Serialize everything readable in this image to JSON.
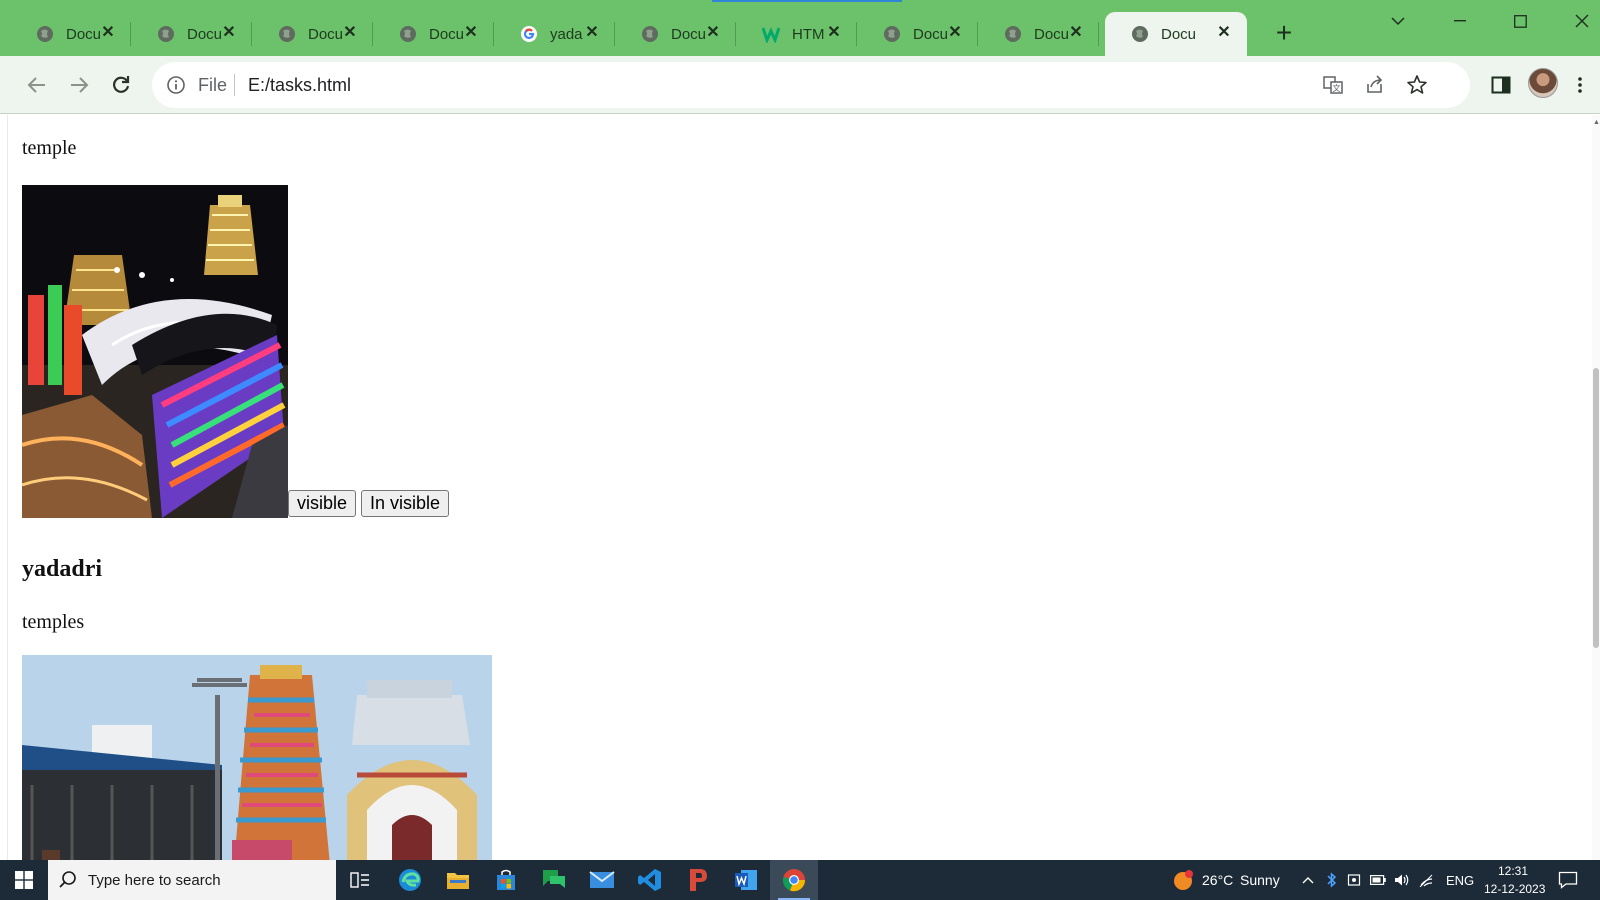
{
  "browser": {
    "tabs": [
      {
        "title": "Docu",
        "icon": "globe-icon"
      },
      {
        "title": "Docu",
        "icon": "globe-icon"
      },
      {
        "title": "Docu",
        "icon": "globe-icon"
      },
      {
        "title": "Docu",
        "icon": "globe-icon"
      },
      {
        "title": "yada",
        "icon": "google-icon"
      },
      {
        "title": "Docu",
        "icon": "globe-icon"
      },
      {
        "title": "HTM",
        "icon": "w3schools-icon"
      },
      {
        "title": "Docu",
        "icon": "globe-icon"
      },
      {
        "title": "Docu",
        "icon": "globe-icon"
      },
      {
        "title": "Docu",
        "icon": "globe-icon",
        "active": true
      }
    ],
    "new_tab": "+",
    "close_glyph": "✕",
    "address": {
      "scheme_label": "File",
      "url": "E:/tasks.html"
    },
    "colors": {
      "tabstrip": "#6cc16b",
      "toolbar": "#eef4ee"
    }
  },
  "page": {
    "paragraph_1": "temple",
    "image_1": {
      "icon": "temple-night-lights-image"
    },
    "buttons": {
      "visible": "visible",
      "invisible": "In visible"
    },
    "heading": "yadadri",
    "paragraph_2": "temples",
    "image_2": {
      "icon": "temple-gopuram-day-image"
    }
  },
  "taskbar": {
    "search_placeholder": "Type here to search",
    "weather": {
      "temp": "26°C",
      "condition": "Sunny"
    },
    "language": "ENG",
    "time": "12:31",
    "date": "12-12-2023",
    "apps": [
      "task-view-icon",
      "edge-icon",
      "file-explorer-icon",
      "store-icon",
      "chat-icon",
      "mail-icon",
      "vscode-icon",
      "app-icon",
      "word-icon",
      "chrome-icon"
    ]
  }
}
